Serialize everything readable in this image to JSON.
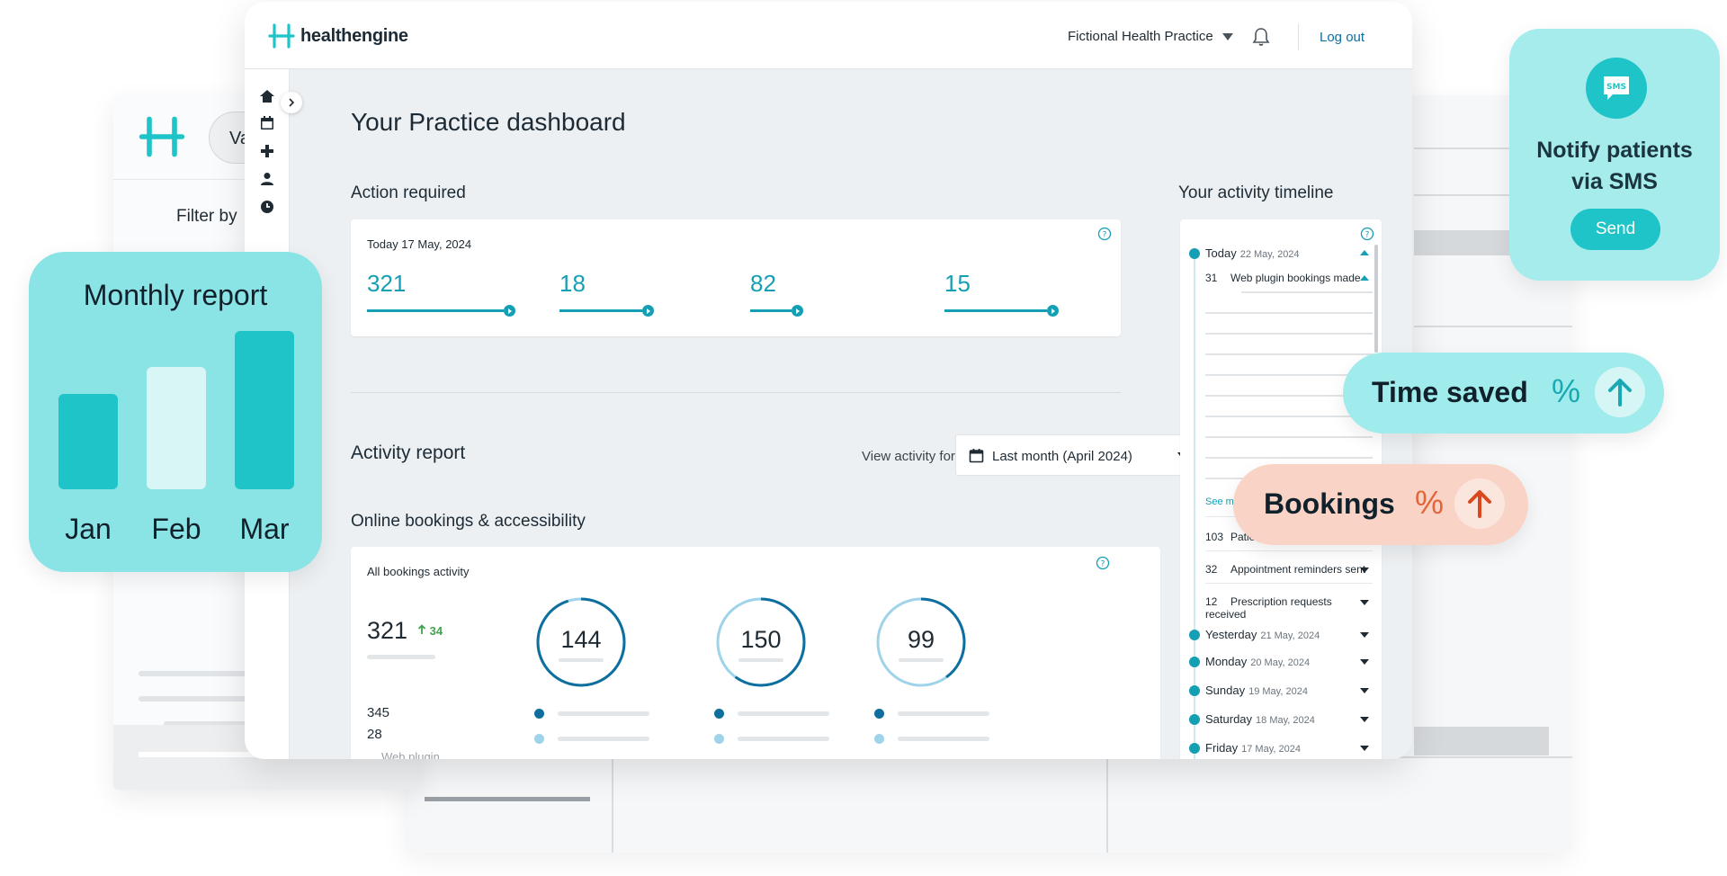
{
  "header": {
    "brand": "healthengine",
    "practice": "Fictional Health Practice",
    "logout": "Log out"
  },
  "background": {
    "pill_text": "Va",
    "filter_by": "Filter by"
  },
  "dashboard": {
    "title": "Your Practice dashboard",
    "action_required": {
      "label": "Action required",
      "date": "Today 17 May, 2024",
      "metrics": [
        "321",
        "18",
        "82",
        "15"
      ]
    },
    "activity_report": {
      "label": "Activity report",
      "view_for": "View activity for",
      "period": "Last month (April 2024)"
    },
    "online_bookings": {
      "label": "Online bookings & accessibility",
      "card_title": "All bookings activity",
      "total": "321",
      "delta": "34",
      "sub_values": [
        "345",
        "28"
      ],
      "web_plugin": "Web plugin",
      "rings": [
        {
          "value": "144",
          "fraction": 0.95
        },
        {
          "value": "150",
          "fraction": 0.6
        },
        {
          "value": "99",
          "fraction": 0.4
        }
      ]
    }
  },
  "timeline": {
    "title": "Your activity timeline",
    "today": {
      "label": "Today",
      "date": "22 May, 2024"
    },
    "items": [
      {
        "count": "31",
        "label": "Web plugin bookings made"
      },
      {
        "count": "103",
        "label": "Patient"
      },
      {
        "count": "32",
        "label": "Appointment reminders sent"
      },
      {
        "count": "12",
        "label": "Prescription requests received"
      }
    ],
    "see_more": "See more",
    "days": [
      {
        "label": "Yesterday",
        "date": "21 May, 2024"
      },
      {
        "label": "Monday",
        "date": "20 May, 2024"
      },
      {
        "label": "Sunday",
        "date": "19 May, 2024"
      },
      {
        "label": "Saturday",
        "date": "18 May, 2024"
      },
      {
        "label": "Friday",
        "date": "17 May, 2024"
      }
    ]
  },
  "monthly_report": {
    "title": "Monthly report",
    "months": [
      "Jan",
      "Feb",
      "Mar"
    ],
    "values": [
      0.6,
      0.77,
      1.0
    ]
  },
  "sms": {
    "badge": "SMS",
    "title_line1": "Notify patients",
    "title_line2": "via SMS",
    "button": "Send"
  },
  "time_saved": {
    "label": "Time saved",
    "pct": "%"
  },
  "bookings": {
    "label": "Bookings",
    "pct": "%"
  },
  "colors": {
    "accent": "#159fb4",
    "teal_card": "#8ae3e4",
    "bookings_card": "#f9d4c6",
    "bookings_accent": "#e2653a",
    "ring_dark": "#0e6f9e",
    "ring_light": "#9fd3ea"
  }
}
